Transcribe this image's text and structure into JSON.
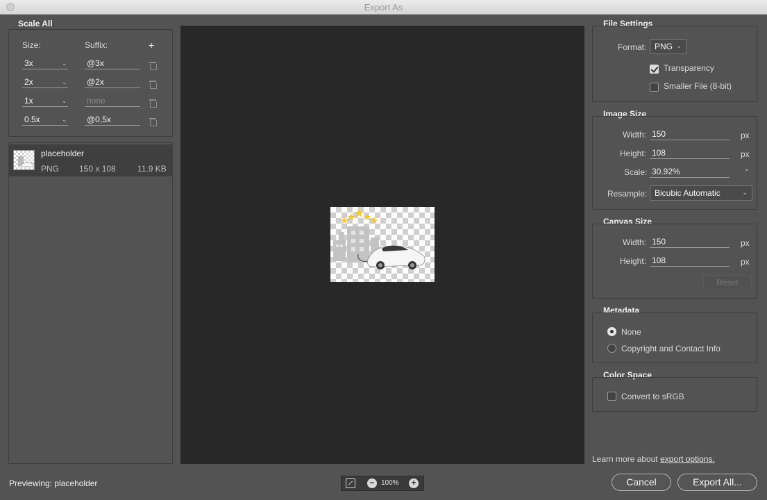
{
  "window": {
    "title": "Export As"
  },
  "scale_all": {
    "title": "Scale All",
    "size_label": "Size:",
    "suffix_label": "Suffix:",
    "add_symbol": "+",
    "rows": [
      {
        "size": "3x",
        "suffix": "@3x",
        "placeholder": false
      },
      {
        "size": "2x",
        "suffix": "@2x",
        "placeholder": false
      },
      {
        "size": "1x",
        "suffix": "none",
        "placeholder": true
      },
      {
        "size": "0.5x",
        "suffix": "@0,5x",
        "placeholder": false
      }
    ]
  },
  "asset": {
    "name": "placeholder",
    "format": "PNG",
    "dimensions": "150 x 108",
    "filesize": "11.9 KB"
  },
  "file_settings": {
    "title": "File Settings",
    "format_label": "Format:",
    "format_value": "PNG",
    "transparency_label": "Transparency",
    "transparency_checked": true,
    "smaller_file_label": "Smaller File (8-bit)",
    "smaller_file_checked": false
  },
  "image_size": {
    "title": "Image Size",
    "width_label": "Width:",
    "width_value": "150",
    "width_unit": "px",
    "height_label": "Height:",
    "height_value": "108",
    "height_unit": "px",
    "scale_label": "Scale:",
    "scale_value": "30.92%",
    "resample_label": "Resample:",
    "resample_value": "Bicubic Automatic"
  },
  "canvas_size": {
    "title": "Canvas Size",
    "width_label": "Width:",
    "width_value": "150",
    "width_unit": "px",
    "height_label": "Height:",
    "height_value": "108",
    "height_unit": "px",
    "reset_label": "Reset"
  },
  "metadata": {
    "title": "Metadata",
    "options": [
      "None",
      "Copyright and Contact Info"
    ],
    "selected": 0
  },
  "color_space": {
    "title": "Color Space",
    "convert_label": "Convert to sRGB",
    "convert_checked": false
  },
  "footer": {
    "learn_more_text": "Learn more about ",
    "learn_more_link": "export options.",
    "previewing_label": "Previewing:",
    "previewing_value": "placeholder",
    "zoom_value": "100%",
    "cancel_label": "Cancel",
    "export_label": "Export All..."
  }
}
